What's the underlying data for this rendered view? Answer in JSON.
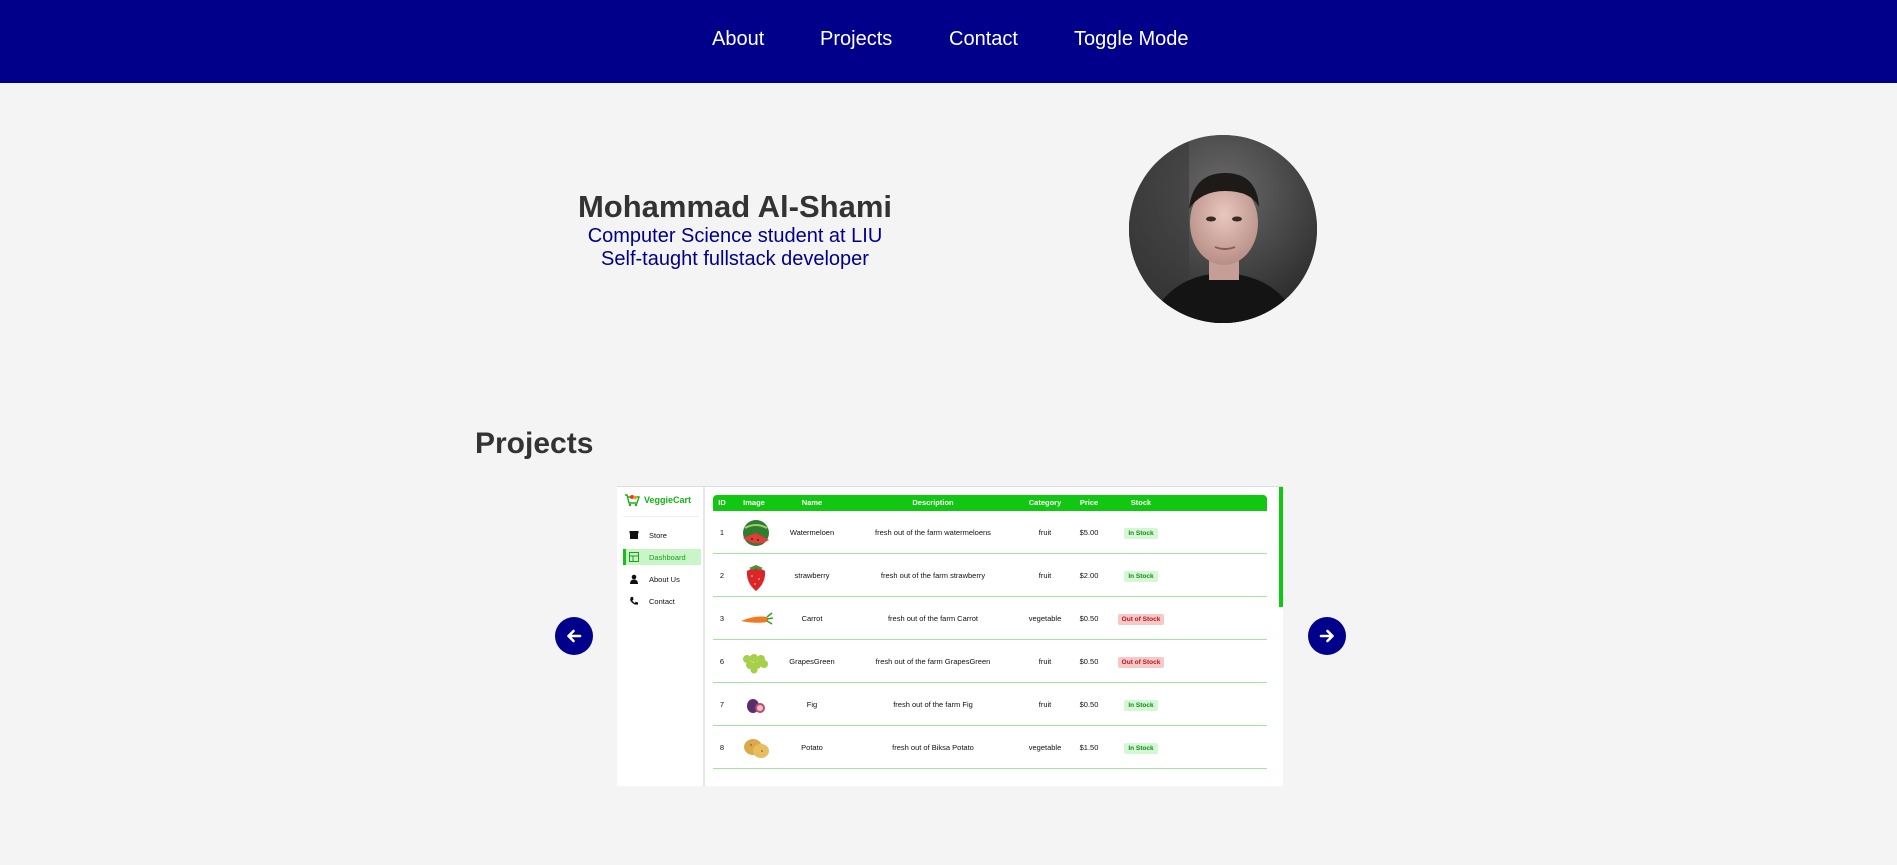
{
  "nav": {
    "about": "About",
    "projects": "Projects",
    "contact": "Contact",
    "toggle": "Toggle Mode",
    "bg_color": "#00008b"
  },
  "hero": {
    "name": "Mohammad Al-Shami",
    "line1": "Computer Science student at LIU",
    "line2": "Self-taught fullstack developer",
    "avatar_icon": "profile-photo"
  },
  "projects": {
    "title": "Projects",
    "prev_icon": "arrow-left-icon",
    "next_icon": "arrow-right-icon",
    "screenshot": {
      "brand": "VeggieCart",
      "sidebar": [
        "Store",
        "Dashboard",
        "About Us",
        "Contact"
      ],
      "active_item": "Dashboard",
      "columns": [
        "ID",
        "Image",
        "Name",
        "Description",
        "Category",
        "Price",
        "Stock"
      ],
      "rows": [
        {
          "id": "1",
          "name": "Watermeloen",
          "desc": "fresh out of the farm watermeloens",
          "cat": "fruit",
          "price": "$5.00",
          "stock": "In Stock",
          "in": true,
          "img": "watermelon"
        },
        {
          "id": "2",
          "name": "strawberry",
          "desc": "fresh out of the farm strawberry",
          "cat": "fruit",
          "price": "$2.00",
          "stock": "In Stock",
          "in": true,
          "img": "strawberry"
        },
        {
          "id": "3",
          "name": "Carrot",
          "desc": "fresh out of the farm Carrot",
          "cat": "vegetable",
          "price": "$0.50",
          "stock": "Out of Stock",
          "in": false,
          "img": "carrot"
        },
        {
          "id": "6",
          "name": "GrapesGreen",
          "desc": "fresh out of the farm GrapesGreen",
          "cat": "fruit",
          "price": "$0.50",
          "stock": "Out of Stock",
          "in": false,
          "img": "grapes"
        },
        {
          "id": "7",
          "name": "Fig",
          "desc": "fresh out of the farm Fig",
          "cat": "fruit",
          "price": "$0.50",
          "stock": "In Stock",
          "in": true,
          "img": "fig"
        },
        {
          "id": "8",
          "name": "Potato",
          "desc": "fresh out of Biksa Potato",
          "cat": "vegetable",
          "price": "$1.50",
          "stock": "In Stock",
          "in": true,
          "img": "potato"
        }
      ]
    }
  },
  "colors": {
    "accent": "#00008b",
    "green": "#11c711",
    "background": "#f4f4f4"
  }
}
